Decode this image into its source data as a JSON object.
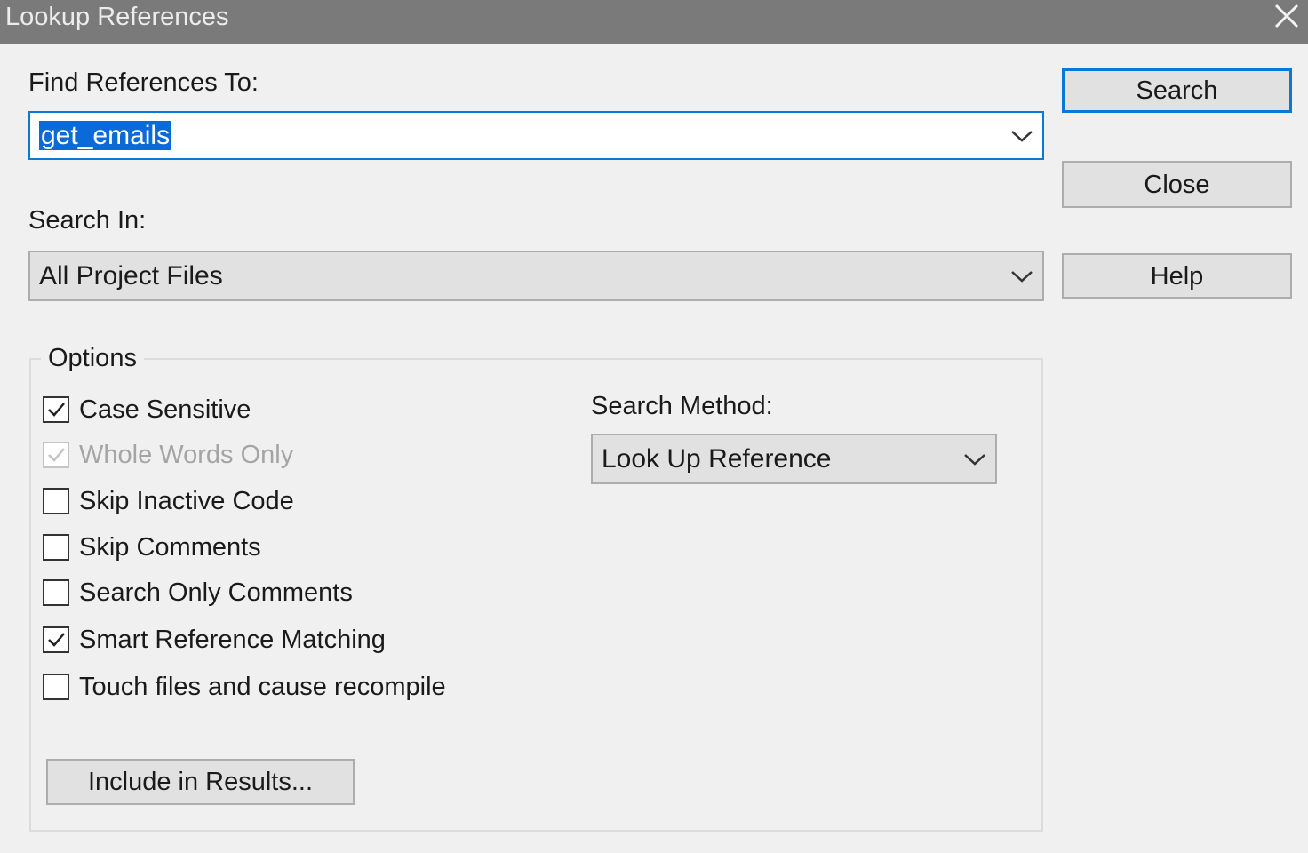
{
  "window": {
    "title": "Lookup References"
  },
  "find": {
    "label": "Find References To:",
    "value": "get_emails"
  },
  "search_in": {
    "label": "Search In:",
    "value": "All Project Files"
  },
  "buttons": {
    "search": "Search",
    "close": "Close",
    "help": "Help"
  },
  "options": {
    "legend": "Options",
    "checkboxes": [
      {
        "label": "Case Sensitive",
        "checked": true,
        "enabled": true
      },
      {
        "label": "Whole Words Only",
        "checked": true,
        "enabled": false
      },
      {
        "label": "Skip Inactive Code",
        "checked": false,
        "enabled": true
      },
      {
        "label": "Skip Comments",
        "checked": false,
        "enabled": true
      },
      {
        "label": "Search Only Comments",
        "checked": false,
        "enabled": true
      },
      {
        "label": "Smart Reference Matching",
        "checked": true,
        "enabled": true
      },
      {
        "label": "Touch files and cause recompile",
        "checked": false,
        "enabled": true
      }
    ],
    "method_label": "Search Method:",
    "method_value": "Look Up Reference",
    "include_button": "Include in Results..."
  },
  "colors": {
    "titlebar": "#7a7a7a",
    "focus_border": "#0a78d7",
    "selection": "#0a6ad7"
  }
}
